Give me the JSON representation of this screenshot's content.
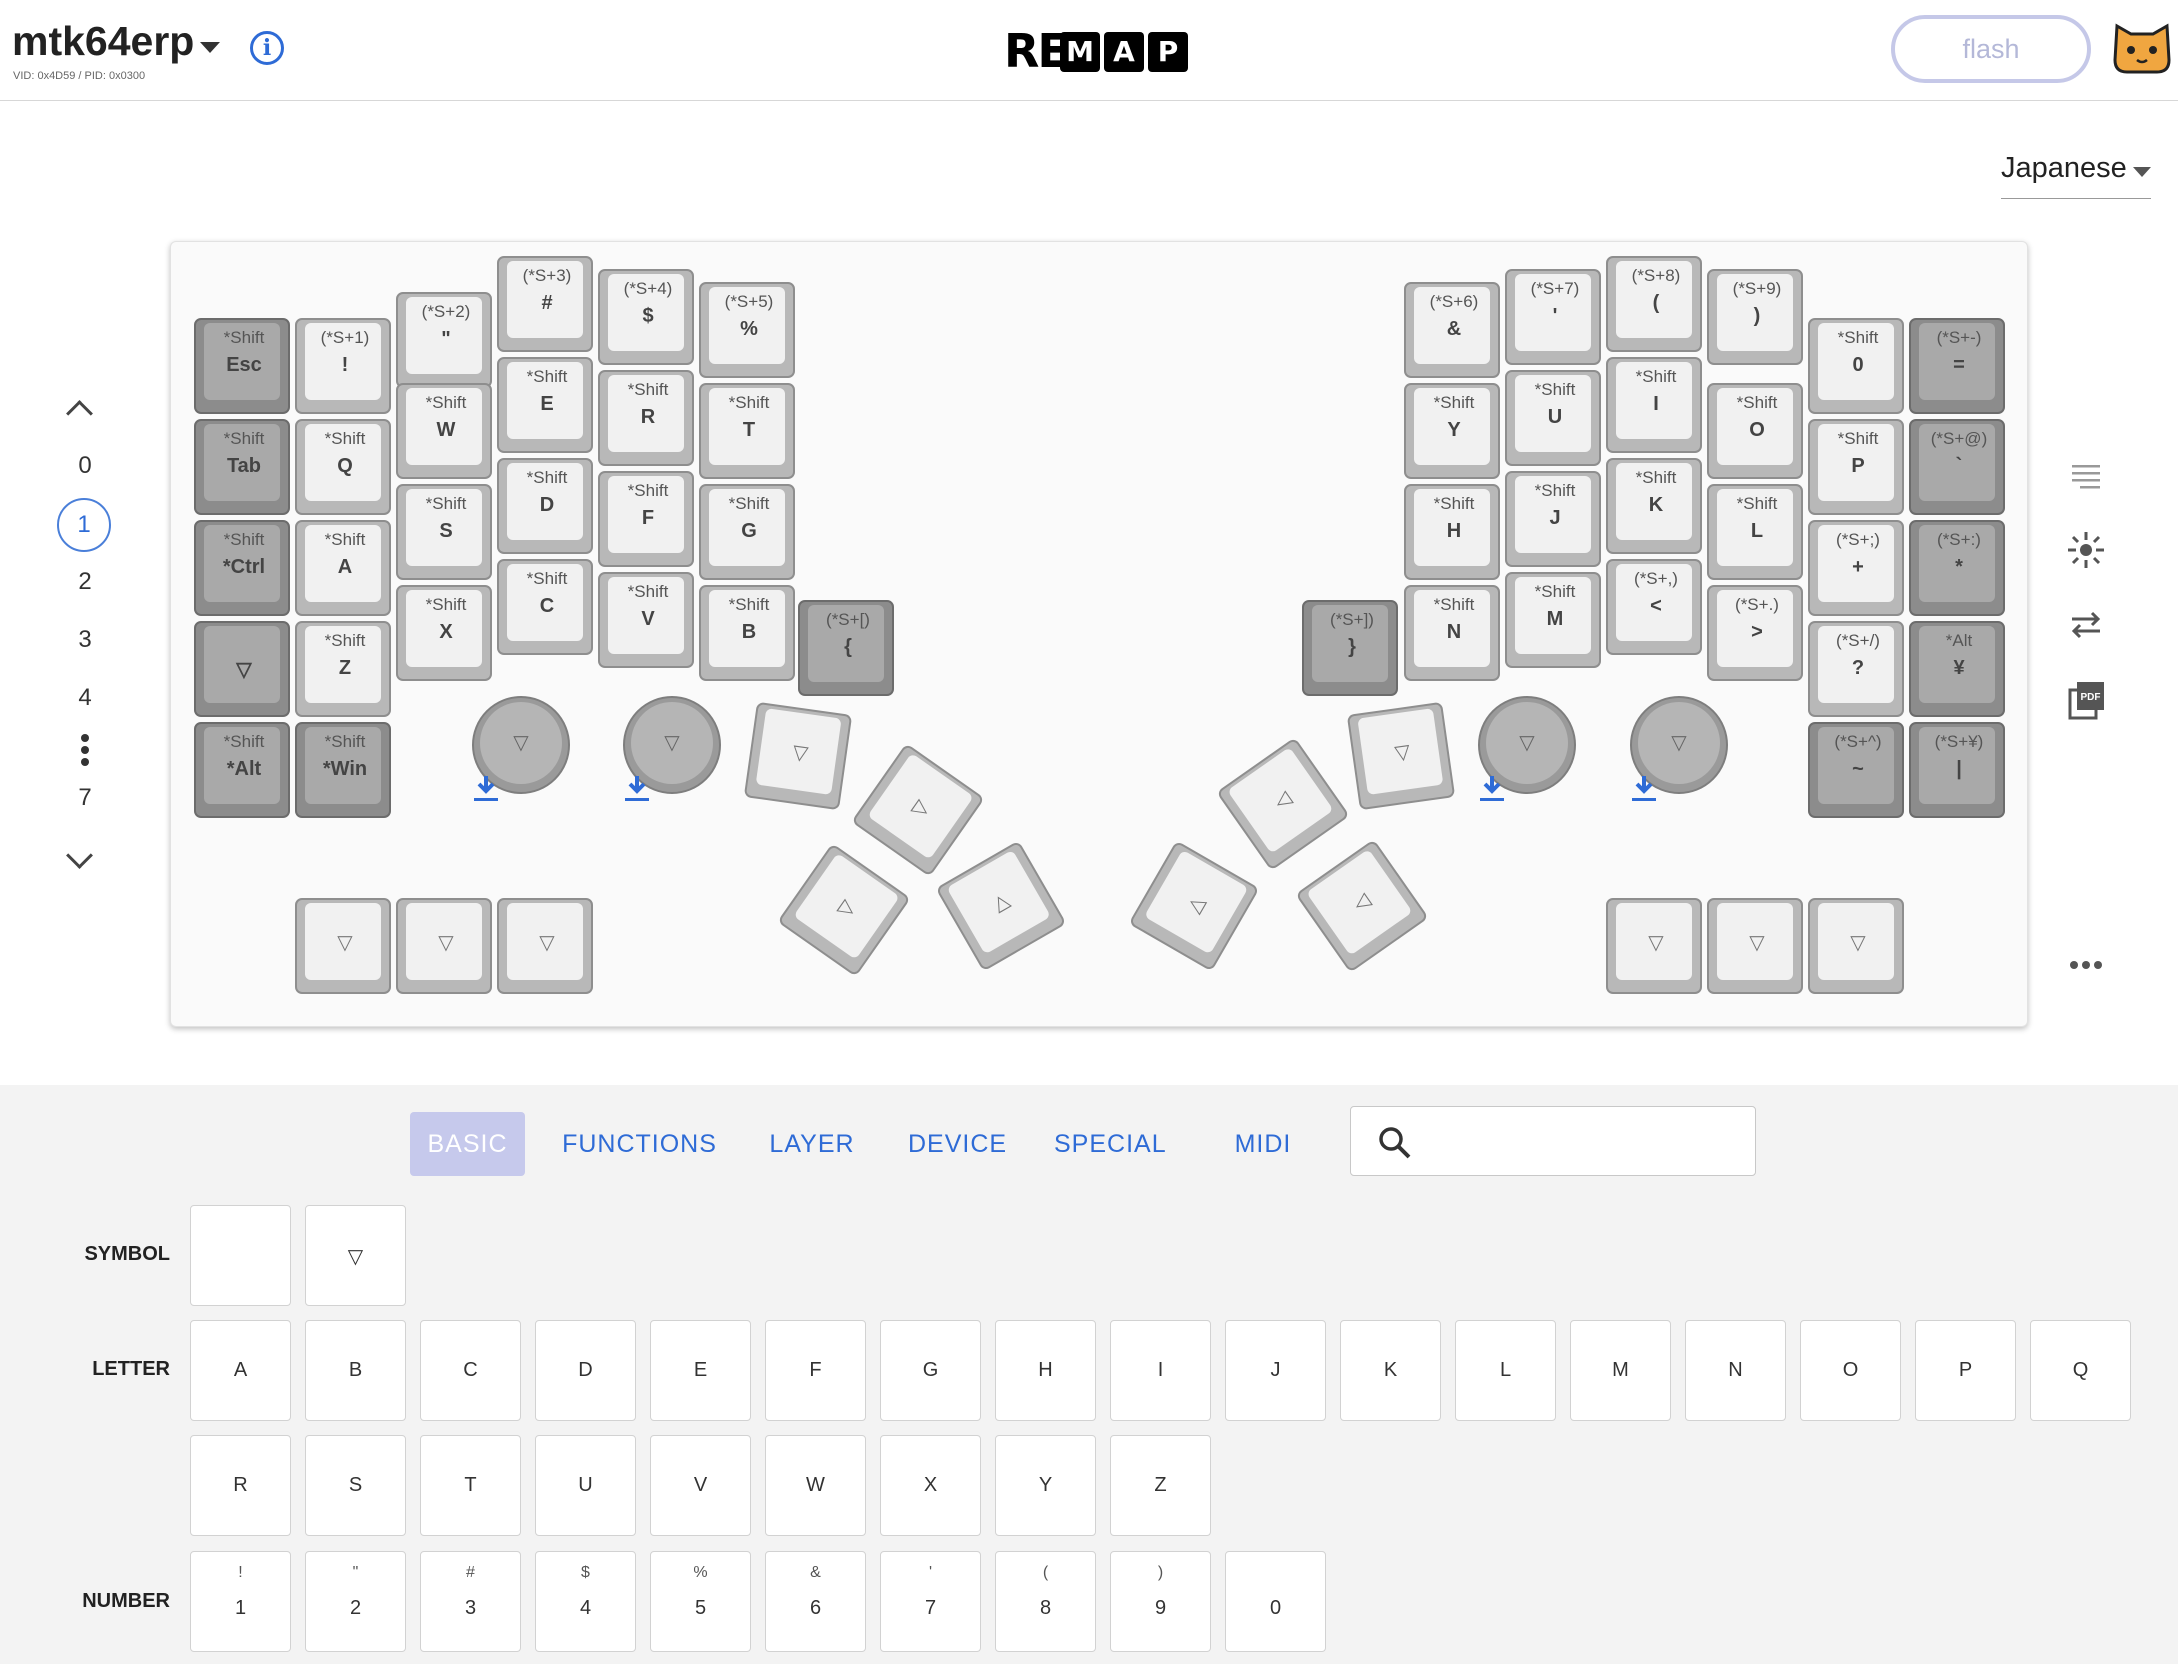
{
  "header": {
    "keyboard_name": "mtk64erp",
    "ids": "VID: 0x4D59 / PID: 0x0300",
    "logo": {
      "re": "RE",
      "letters": [
        "M",
        "A",
        "P"
      ]
    },
    "flash_label": "flash"
  },
  "language": {
    "selected": "Japanese"
  },
  "layers": {
    "numbers": [
      "0",
      "1",
      "2",
      "3",
      "4",
      "7"
    ],
    "active": "1"
  },
  "keyboard": {
    "left": [
      {
        "top": "*Shift",
        "main": "Esc",
        "dark": true
      },
      {
        "top": "(*S+1)",
        "main": "!"
      },
      {
        "top": "(*S+2)",
        "main": "\""
      },
      {
        "top": "(*S+3)",
        "main": "#"
      },
      {
        "top": "(*S+4)",
        "main": "$"
      },
      {
        "top": "(*S+5)",
        "main": "%"
      },
      {
        "top": "*Shift",
        "main": "Tab",
        "dark": true
      },
      {
        "top": "*Shift",
        "main": "Q"
      },
      {
        "top": "*Shift",
        "main": "W"
      },
      {
        "top": "*Shift",
        "main": "E"
      },
      {
        "top": "*Shift",
        "main": "R"
      },
      {
        "top": "*Shift",
        "main": "T"
      },
      {
        "top": "*Shift",
        "main": "*Ctrl",
        "dark": true
      },
      {
        "top": "*Shift",
        "main": "A"
      },
      {
        "top": "*Shift",
        "main": "S"
      },
      {
        "top": "*Shift",
        "main": "D"
      },
      {
        "top": "*Shift",
        "main": "F"
      },
      {
        "top": "*Shift",
        "main": "G"
      },
      {
        "top": "",
        "main": "▽",
        "dark": true
      },
      {
        "top": "*Shift",
        "main": "Z"
      },
      {
        "top": "*Shift",
        "main": "X"
      },
      {
        "top": "*Shift",
        "main": "C"
      },
      {
        "top": "*Shift",
        "main": "V"
      },
      {
        "top": "*Shift",
        "main": "B"
      },
      {
        "top": "(*S+[)",
        "main": "{",
        "dark": true
      },
      {
        "top": "*Shift",
        "main": "*Alt",
        "dark": true
      },
      {
        "top": "*Shift",
        "main": "*Win",
        "dark": true
      }
    ],
    "right": [
      {
        "top": "(*S+6)",
        "main": "&"
      },
      {
        "top": "(*S+7)",
        "main": "'"
      },
      {
        "top": "(*S+8)",
        "main": "("
      },
      {
        "top": "(*S+9)",
        "main": ")"
      },
      {
        "top": "*Shift",
        "main": "0"
      },
      {
        "top": "(*S+-)",
        "main": "=",
        "dark": true
      },
      {
        "top": "*Shift",
        "main": "Y"
      },
      {
        "top": "*Shift",
        "main": "U"
      },
      {
        "top": "*Shift",
        "main": "I"
      },
      {
        "top": "*Shift",
        "main": "O"
      },
      {
        "top": "*Shift",
        "main": "P"
      },
      {
        "top": "(*S+@)",
        "main": "`",
        "dark": true
      },
      {
        "top": "*Shift",
        "main": "H"
      },
      {
        "top": "*Shift",
        "main": "J"
      },
      {
        "top": "*Shift",
        "main": "K"
      },
      {
        "top": "*Shift",
        "main": "L"
      },
      {
        "top": "(*S+;)",
        "main": "+"
      },
      {
        "top": "(*S+:)",
        "main": "*",
        "dark": true
      },
      {
        "top": "(*S+])",
        "main": "}",
        "dark": true
      },
      {
        "top": "*Shift",
        "main": "N"
      },
      {
        "top": "*Shift",
        "main": "M"
      },
      {
        "top": "(*S+,)",
        "main": "<"
      },
      {
        "top": "(*S+.)",
        "main": ">"
      },
      {
        "top": "(*S+/)",
        "main": "?"
      },
      {
        "top": "*Alt",
        "main": "¥",
        "dark": true
      },
      {
        "top": "(*S+^)",
        "main": "~",
        "dark": true
      },
      {
        "top": "(*S+¥)",
        "main": "|",
        "dark": true
      }
    ],
    "blank_glyph": "▽",
    "thumb_glyphs": [
      "▽",
      "▷",
      "▷",
      "△",
      "◁",
      "◁",
      "△"
    ]
  },
  "tabs": [
    "BASIC",
    "FUNCTIONS",
    "LAYER",
    "DEVICE",
    "SPECIAL",
    "MIDI"
  ],
  "categories": {
    "symbol": "SYMBOL",
    "letter": "LETTER",
    "number": "NUMBER"
  },
  "symbol_keys": [
    "",
    "▽"
  ],
  "letters": [
    "A",
    "B",
    "C",
    "D",
    "E",
    "F",
    "G",
    "H",
    "I",
    "J",
    "K",
    "L",
    "M",
    "N",
    "O",
    "P",
    "Q",
    "R",
    "S",
    "T",
    "U",
    "V",
    "W",
    "X",
    "Y",
    "Z"
  ],
  "numbers": [
    {
      "shift": "!",
      "key": "1"
    },
    {
      "shift": "\"",
      "key": "2"
    },
    {
      "shift": "#",
      "key": "3"
    },
    {
      "shift": "$",
      "key": "4"
    },
    {
      "shift": "%",
      "key": "5"
    },
    {
      "shift": "&",
      "key": "6"
    },
    {
      "shift": "'",
      "key": "7"
    },
    {
      "shift": "(",
      "key": "8"
    },
    {
      "shift": ")",
      "key": "9"
    },
    {
      "shift": "",
      "key": "0"
    }
  ],
  "colors": {
    "accent": "#2e6bd6",
    "tab_active": "#c6c9ec",
    "flash_border": "#c5c8e8"
  }
}
